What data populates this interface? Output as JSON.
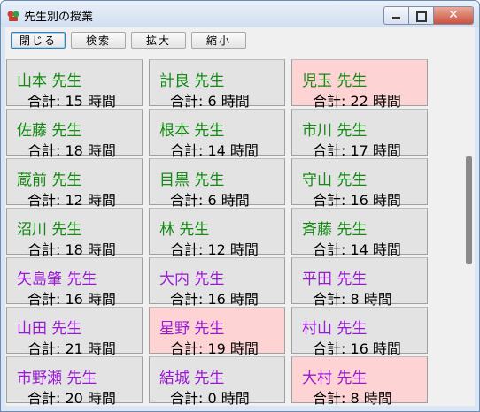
{
  "window": {
    "title": "先生別の授業"
  },
  "toolbar": {
    "buttons": [
      "閉じる",
      "検索",
      "拡大",
      "縮小"
    ]
  },
  "colors": {
    "green": "#118b11",
    "purple": "#9b19d6",
    "pink": "#fdd3d3"
  },
  "cards": [
    [
      {
        "name": "山本 先生",
        "total": "合計: 15 時間",
        "group": "green",
        "pink": false
      },
      {
        "name": "佐藤 先生",
        "total": "合計: 18 時間",
        "group": "green",
        "pink": false
      },
      {
        "name": "蔵前 先生",
        "total": "合計: 12 時間",
        "group": "green",
        "pink": false
      },
      {
        "name": "沼川 先生",
        "total": "合計: 18 時間",
        "group": "green",
        "pink": false
      },
      {
        "name": "矢島肇 先生",
        "total": "合計: 16 時間",
        "group": "purple",
        "pink": false
      },
      {
        "name": "山田 先生",
        "total": "合計: 21 時間",
        "group": "purple",
        "pink": false
      },
      {
        "name": "市野瀬 先生",
        "total": "合計: 20 時間",
        "group": "purple",
        "pink": false
      }
    ],
    [
      {
        "name": "計良 先生",
        "total": "合計: 6 時間",
        "group": "green",
        "pink": false
      },
      {
        "name": "根本 先生",
        "total": "合計: 14 時間",
        "group": "green",
        "pink": false
      },
      {
        "name": "目黒 先生",
        "total": "合計: 6 時間",
        "group": "green",
        "pink": false
      },
      {
        "name": "林 先生",
        "total": "合計: 12 時間",
        "group": "green",
        "pink": false
      },
      {
        "name": "大内 先生",
        "total": "合計: 16 時間",
        "group": "purple",
        "pink": false
      },
      {
        "name": "星野 先生",
        "total": "合計: 19 時間",
        "group": "purple",
        "pink": true
      },
      {
        "name": "結城 先生",
        "total": "合計: 0 時間",
        "group": "purple",
        "pink": false
      }
    ],
    [
      {
        "name": "児玉 先生",
        "total": "合計: 22 時間",
        "group": "green",
        "pink": true
      },
      {
        "name": "市川 先生",
        "total": "合計: 17 時間",
        "group": "green",
        "pink": false
      },
      {
        "name": "守山 先生",
        "total": "合計: 16 時間",
        "group": "green",
        "pink": false
      },
      {
        "name": "斉藤 先生",
        "total": "合計: 14 時間",
        "group": "green",
        "pink": false
      },
      {
        "name": "平田 先生",
        "total": "合計: 8 時間",
        "group": "purple",
        "pink": false
      },
      {
        "name": "村山 先生",
        "total": "合計: 16 時間",
        "group": "purple",
        "pink": false
      },
      {
        "name": "大村 先生",
        "total": "合計: 8 時間",
        "group": "purple",
        "pink": true
      }
    ]
  ]
}
